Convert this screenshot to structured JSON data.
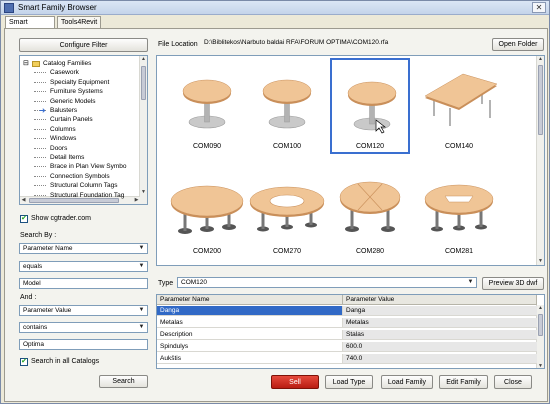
{
  "window": {
    "title": "Smart Family Browser",
    "close_glyph": "✕"
  },
  "tabs": [
    {
      "label": "Smart Browser"
    },
    {
      "label": "Tools4Revit"
    }
  ],
  "left": {
    "configure_filter_label": "Configure Filter",
    "tree": {
      "items": [
        {
          "label": "Catalog Families",
          "expander": "⊟"
        },
        {
          "label": "Casework"
        },
        {
          "label": "Specialty Equipment"
        },
        {
          "label": "Furniture Systems"
        },
        {
          "label": "Generic Models"
        },
        {
          "label": "Balusters"
        },
        {
          "label": "Curtain Panels"
        },
        {
          "label": "Columns"
        },
        {
          "label": "Windows"
        },
        {
          "label": "Doors"
        },
        {
          "label": "Detail Items"
        },
        {
          "label": "Brace in Plan View Symbo"
        },
        {
          "label": "Connection Symbols"
        },
        {
          "label": "Structural Column Tags"
        },
        {
          "label": "Structural Foundation Tag"
        }
      ]
    },
    "show_cgtrader": {
      "label": "Show cgtrader.com",
      "checked": true
    },
    "search_by_label": "Search By :",
    "search_by_value": "Parameter Name",
    "operator_value": "equals",
    "value_text": "Model",
    "and_label": "And :",
    "and_param_value": "Parameter Value",
    "and_operator_value": "contains",
    "and_value_text": "Optima",
    "search_all": {
      "label": "Search in all Catalogs",
      "checked": true
    },
    "search_button_label": "Search"
  },
  "right": {
    "file_location_label": "File Location",
    "file_location_value": "D:\\Biblitekos\\Narbuto baldai RFA\\FORUM OPTIMA\\COM120.rfa",
    "open_folder_label": "Open Folder",
    "gallery": [
      {
        "name": "COM090",
        "shape": "round-pedestal",
        "selected": false
      },
      {
        "name": "COM100",
        "shape": "round-pedestal",
        "selected": false
      },
      {
        "name": "COM120",
        "shape": "round-pedestal",
        "selected": true
      },
      {
        "name": "COM140",
        "shape": "rect-4leg",
        "selected": false
      },
      {
        "name": "COM200",
        "shape": "oval-3leg",
        "selected": false
      },
      {
        "name": "COM270",
        "shape": "oval-ring",
        "selected": false
      },
      {
        "name": "COM280",
        "shape": "oval-segmented",
        "selected": false
      },
      {
        "name": "COM281",
        "shape": "oval-split",
        "selected": false
      }
    ],
    "type_label": "Type",
    "type_value": "COM120",
    "preview_3d_label": "Preview 3D dwf",
    "params": {
      "headers": [
        "Parameter Name",
        "Parameter Value"
      ],
      "rows": [
        {
          "name": "Danga",
          "value": "Danga",
          "selected": true
        },
        {
          "name": "Metalas",
          "value": "Metalas"
        },
        {
          "name": "Description",
          "value": "Stalas"
        },
        {
          "name": "Spindulys",
          "value": "600.0"
        },
        {
          "name": "Aukštis",
          "value": "740.0"
        }
      ]
    },
    "actions": {
      "sell": "Sell",
      "load_type": "Load Type",
      "load_family": "Load Family",
      "edit_family": "Edit Family",
      "close": "Close"
    }
  },
  "colors": {
    "wood_top": "#f0c596",
    "wood_edge": "#c98f5a",
    "selection": "#3169c6",
    "sell_red": "#c8281b"
  }
}
